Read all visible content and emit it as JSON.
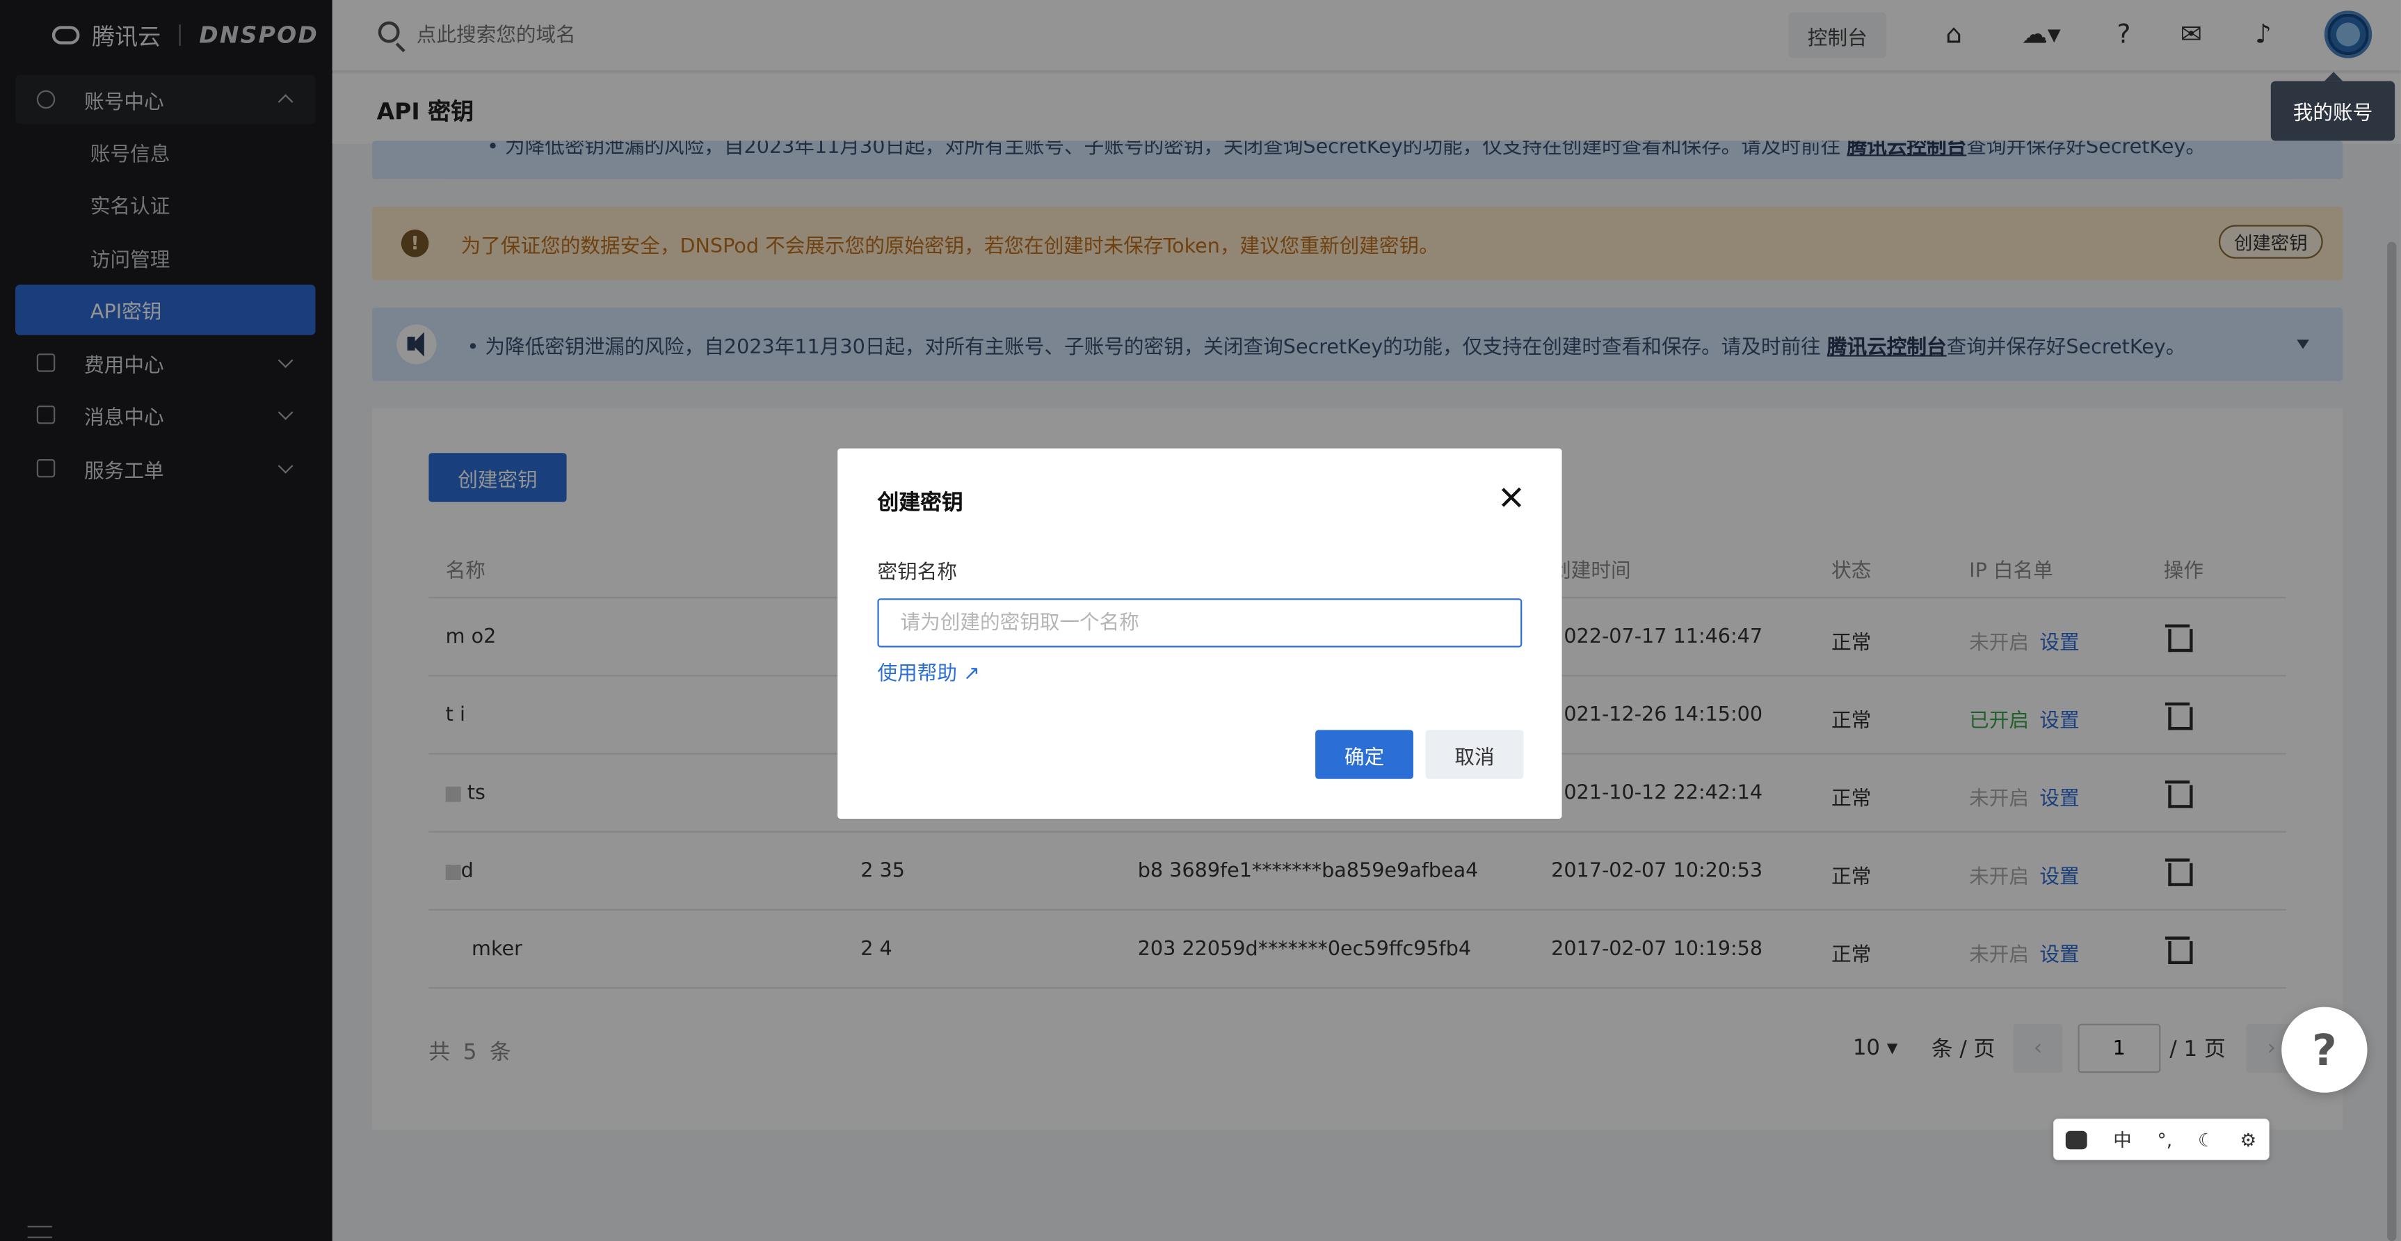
{
  "sidebar": {
    "logo_text": "腾讯云",
    "brand_text": "DNSPOD",
    "groups": [
      {
        "label": "账号中心"
      },
      {
        "label": "费用中心"
      },
      {
        "label": "消息中心"
      },
      {
        "label": "服务工单"
      }
    ],
    "sub_items": [
      {
        "label": "账号信息"
      },
      {
        "label": "实名认证"
      },
      {
        "label": "访问管理"
      },
      {
        "label": "API密钥"
      }
    ]
  },
  "topbar": {
    "search_placeholder": "点此搜索您的域名",
    "console_label": "控制台",
    "tooltip": "我的账号"
  },
  "page": {
    "title": "API 密钥",
    "notice_top": "• 为降低密钥泄漏的风险，自2023年11月30日起，对所有主账号、子账号的密钥，关闭查询SecretKey的功能，仅支持在创建时查看和保存。请及时前往",
    "notice_top_link": "腾讯云控制台",
    "notice_top_tail": "查询并保存好SecretKey。",
    "warning_text": "为了保证您的数据安全，DNSPod 不会展示您的原始密钥，若您在创建时未保存Token，建议您重新创建密钥。",
    "warning_button": "创建密钥",
    "notice_text": "• 为降低密钥泄漏的风险，自2023年11月30日起，对所有主账号、子账号的密钥，关闭查询SecretKey的功能，仅支持在创建时查看和保存。请及时前往",
    "notice_link": "腾讯云控制台",
    "notice_tail": "查询并保存好SecretKey。"
  },
  "table": {
    "create_button": "创建密钥",
    "headers": [
      "名称",
      "创建时间",
      "状态",
      "IP 白名单",
      "操作"
    ],
    "rows": [
      {
        "name": "m   o2",
        "id": "",
        "key": "",
        "time": "2022-07-17 11:46:47",
        "status": "正常",
        "ip": "未开启",
        "ip_action": "设置"
      },
      {
        "name": "t    i",
        "id": "",
        "key": "",
        "time": "2021-12-26 14:15:00",
        "status": "正常",
        "ip": "已开启",
        "ip_action": "设置"
      },
      {
        "name": "ts",
        "id": "",
        "key": "",
        "time": "2021-10-12 22:42:14",
        "status": "正常",
        "ip": "未开启",
        "ip_action": "设置"
      },
      {
        "name": "d",
        "id": "2  35",
        "key": "b8  3689fe1*******ba859e9afbea4",
        "time": "2017-02-07 10:20:53",
        "status": "正常",
        "ip": "未开启",
        "ip_action": "设置"
      },
      {
        "name": "mker",
        "id": "2  4",
        "key": "203 22059d*******0ec59ffc95fb4",
        "time": "2017-02-07 10:19:58",
        "status": "正常",
        "ip": "未开启",
        "ip_action": "设置"
      }
    ],
    "total": "共 5 条",
    "page_size": "10 ▾",
    "per_page": "条 / 页",
    "page_value": "1",
    "page_total": "/ 1 页"
  },
  "modal": {
    "title": "创建密钥",
    "field_label": "密钥名称",
    "field_placeholder": "请为创建的密钥取一个名称",
    "help_link": "使用帮助 ↗",
    "ok": "确定",
    "cancel": "取消"
  },
  "ime": [
    "中",
    "°,"
  ],
  "colors": {
    "primary": "#2b6fd6",
    "sidebar": "#1c1d1f",
    "warning": "#c2701d"
  }
}
